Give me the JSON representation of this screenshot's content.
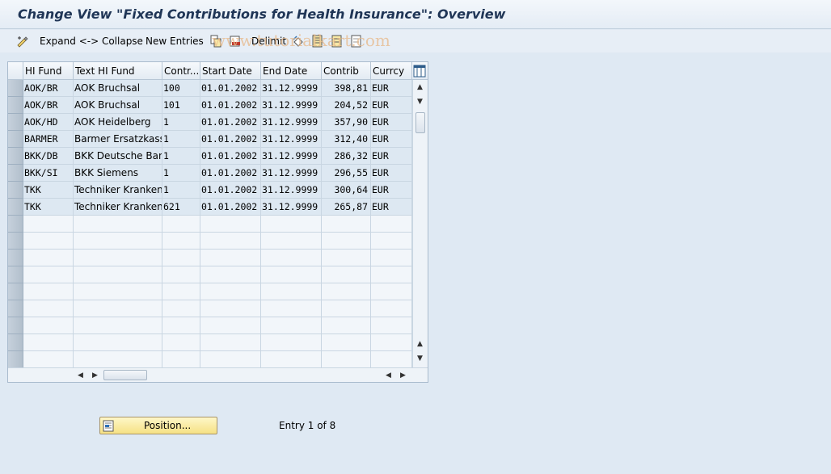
{
  "window": {
    "title": "Change View \"Fixed Contributions for Health Insurance\": Overview"
  },
  "toolbar": {
    "expand_collapse_label": "Expand <-> Collapse",
    "new_entries_label": "New Entries",
    "delimit_label": "Delimit"
  },
  "watermark": "www.tutorialkart.com",
  "table": {
    "columns": [
      "HI Fund",
      "Text HI Fund",
      "Contr...",
      "Start Date",
      "End Date",
      "Contrib",
      "Curr­cy"
    ],
    "rows": [
      {
        "hi_fund": "AOK/BR",
        "text": "AOK Bruchsal",
        "contr": "100",
        "start": "01.01.2002",
        "end": "31.12.9999",
        "contrib": "398,81",
        "currency": "EUR"
      },
      {
        "hi_fund": "AOK/BR",
        "text": "AOK Bruchsal",
        "contr": "101",
        "start": "01.01.2002",
        "end": "31.12.9999",
        "contrib": "204,52",
        "currency": "EUR"
      },
      {
        "hi_fund": "AOK/HD",
        "text": "AOK Heidelberg",
        "contr": "1",
        "start": "01.01.2002",
        "end": "31.12.9999",
        "contrib": "357,90",
        "currency": "EUR"
      },
      {
        "hi_fund": "BARMER",
        "text": "Barmer Ersatzkasse",
        "contr": "1",
        "start": "01.01.2002",
        "end": "31.12.9999",
        "contrib": "312,40",
        "currency": "EUR"
      },
      {
        "hi_fund": "BKK/DB",
        "text": "BKK Deutsche Bank",
        "contr": "1",
        "start": "01.01.2002",
        "end": "31.12.9999",
        "contrib": "286,32",
        "currency": "EUR"
      },
      {
        "hi_fund": "BKK/SI",
        "text": "BKK Siemens",
        "contr": "1",
        "start": "01.01.2002",
        "end": "31.12.9999",
        "contrib": "296,55",
        "currency": "EUR"
      },
      {
        "hi_fund": "TKK",
        "text": "Techniker Kranken...",
        "contr": "1",
        "start": "01.01.2002",
        "end": "31.12.9999",
        "contrib": "300,64",
        "currency": "EUR"
      },
      {
        "hi_fund": "TKK",
        "text": "Techniker Kranken...",
        "contr": "621",
        "start": "01.01.2002",
        "end": "31.12.9999",
        "contrib": "265,87",
        "currency": "EUR"
      }
    ]
  },
  "footer": {
    "position_button_label": "Position...",
    "entry_info": "Entry 1 of 8"
  },
  "colors": {
    "background": "#dfe9f3",
    "title_text": "#1f3556",
    "button_yellow": "#f6e184"
  }
}
